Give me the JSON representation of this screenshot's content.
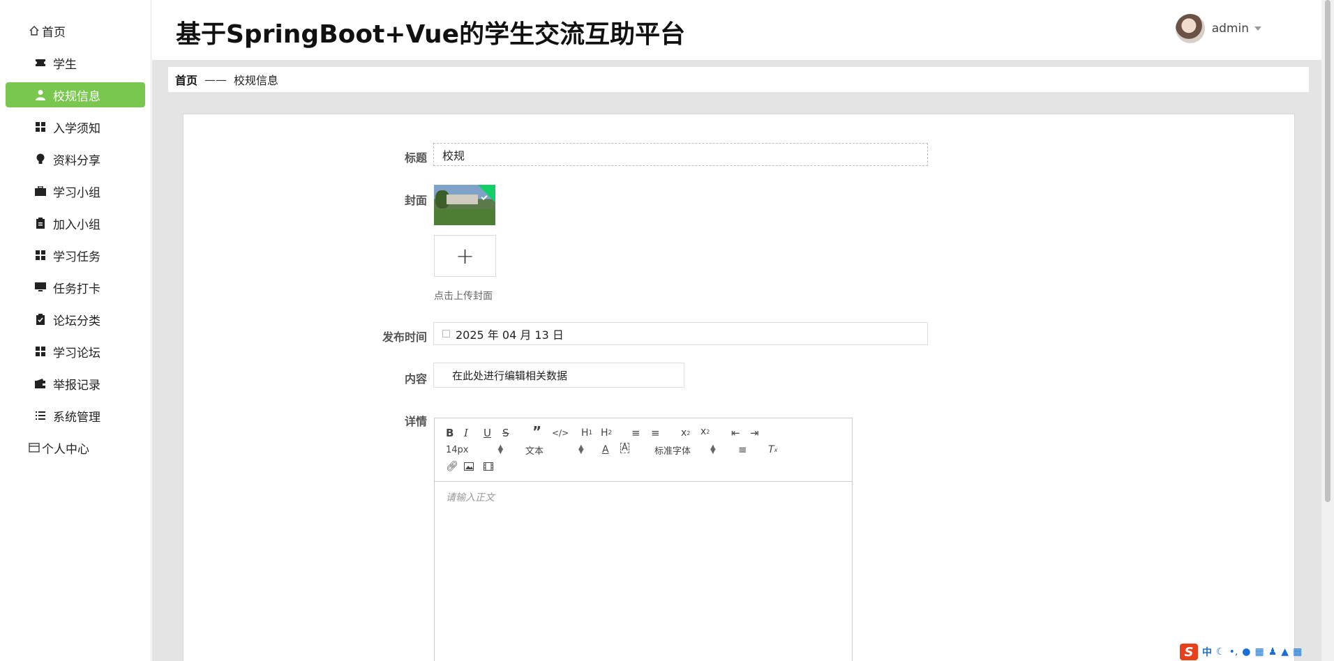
{
  "app_title": "基于SpringBoot+Vue的学生交流互助平台",
  "user": {
    "name": "admin"
  },
  "sidebar": {
    "items": [
      {
        "label": "首页",
        "icon": "home-icon"
      },
      {
        "label": "学生",
        "icon": "ticket-icon"
      },
      {
        "label": "校规信息",
        "icon": "user-icon",
        "active": true
      },
      {
        "label": "入学须知",
        "icon": "grid-icon"
      },
      {
        "label": "资料分享",
        "icon": "bulb-icon"
      },
      {
        "label": "学习小组",
        "icon": "briefcase-icon"
      },
      {
        "label": "加入小组",
        "icon": "clipboard-icon"
      },
      {
        "label": "学习任务",
        "icon": "grid-icon"
      },
      {
        "label": "任务打卡",
        "icon": "monitor-icon"
      },
      {
        "label": "论坛分类",
        "icon": "checklist-icon"
      },
      {
        "label": "学习论坛",
        "icon": "grid-icon"
      },
      {
        "label": "举报记录",
        "icon": "wallet-icon"
      },
      {
        "label": "系统管理",
        "icon": "list-icon"
      },
      {
        "label": "个人中心",
        "icon": "card-icon"
      }
    ],
    "active_color": "#7ac74f"
  },
  "breadcrumb": {
    "home": "首页",
    "separator": "——",
    "current": "校规信息"
  },
  "form": {
    "title_label": "标题",
    "title_value": "校规",
    "cover_label": "封面",
    "upload_plus": "+",
    "upload_hint": "点击上传封面",
    "date_label": "发布时间",
    "date_value": "2025 年 04 月 13 日",
    "content_label": "内容",
    "content_placeholder": "在此处进行编辑相关数据",
    "detail_label": "详情",
    "editor": {
      "font_size": "14px",
      "text_style": "文本",
      "font_family": "标准字体",
      "placeholder": "请输入正文"
    }
  },
  "ime": {
    "logo": "S",
    "mode": "中"
  }
}
